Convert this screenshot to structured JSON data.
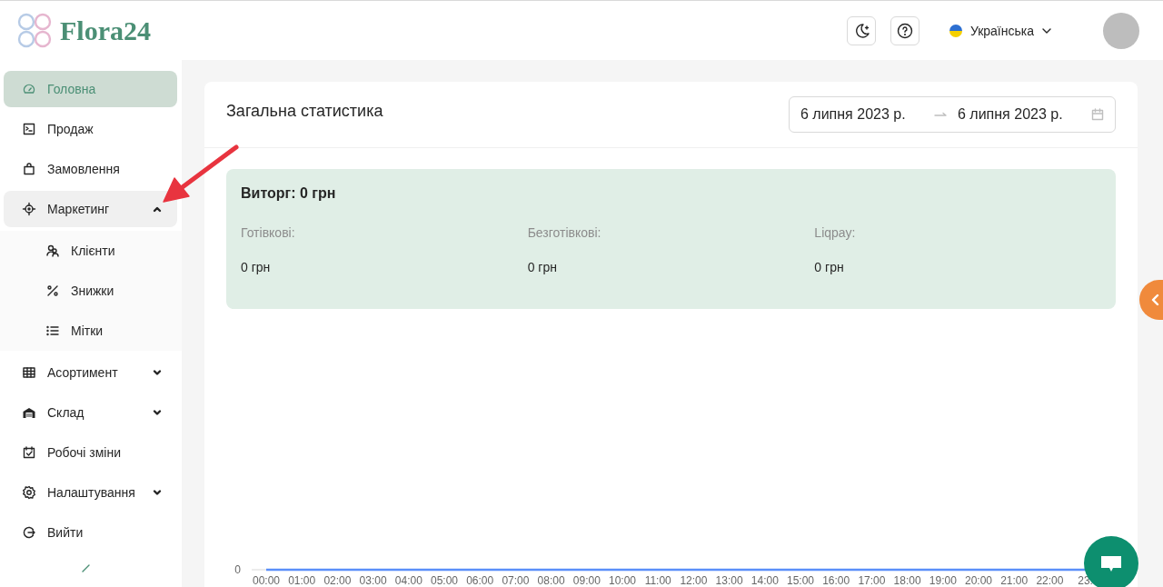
{
  "header": {
    "logo": "Flora24",
    "language": {
      "label": "Українська"
    }
  },
  "sidebar": {
    "items": [
      {
        "label": "Головна",
        "kind": "link",
        "selected": true
      },
      {
        "label": "Продаж",
        "kind": "link",
        "selected": false
      },
      {
        "label": "Замовлення",
        "kind": "link",
        "selected": false
      },
      {
        "label": "Маркетинг",
        "kind": "group",
        "selected": false,
        "expanded": true,
        "children": [
          {
            "label": "Клієнти",
            "selected": false
          },
          {
            "label": "Знижки",
            "selected": false
          },
          {
            "label": "Мітки",
            "selected": false
          }
        ]
      },
      {
        "label": "Асортимент",
        "kind": "group",
        "selected": false,
        "expanded": false
      },
      {
        "label": "Склад",
        "kind": "group",
        "selected": false,
        "expanded": false
      },
      {
        "label": "Робочі зміни",
        "kind": "link",
        "selected": false
      },
      {
        "label": "Налаштування",
        "kind": "group",
        "selected": false,
        "expanded": false
      },
      {
        "label": "Вийти",
        "kind": "link",
        "selected": false
      }
    ]
  },
  "card": {
    "title": "Загальна статистика",
    "date_range": {
      "start": "6 липня 2023 р.",
      "end": "6 липня 2023 р."
    },
    "revenue": {
      "title": "Виторг: 0 грн",
      "methods": [
        {
          "label": "Готівкові:",
          "value": "0 грн"
        },
        {
          "label": "Безготівкові:",
          "value": "0 грн"
        },
        {
          "label": "Liqpay:",
          "value": "0 грн"
        }
      ]
    },
    "chart": {
      "y_label": "0",
      "x_labels": [
        "00:00",
        "01:00",
        "02:00",
        "03:00",
        "04:00",
        "05:00",
        "06:00",
        "07:00",
        "08:00",
        "09:00",
        "10:00",
        "11:00",
        "12:00",
        "13:00",
        "14:00",
        "15:00",
        "16:00",
        "17:00",
        "18:00",
        "19:00",
        "20:00",
        "21:00",
        "22:00",
        "23:"
      ]
    }
  }
}
